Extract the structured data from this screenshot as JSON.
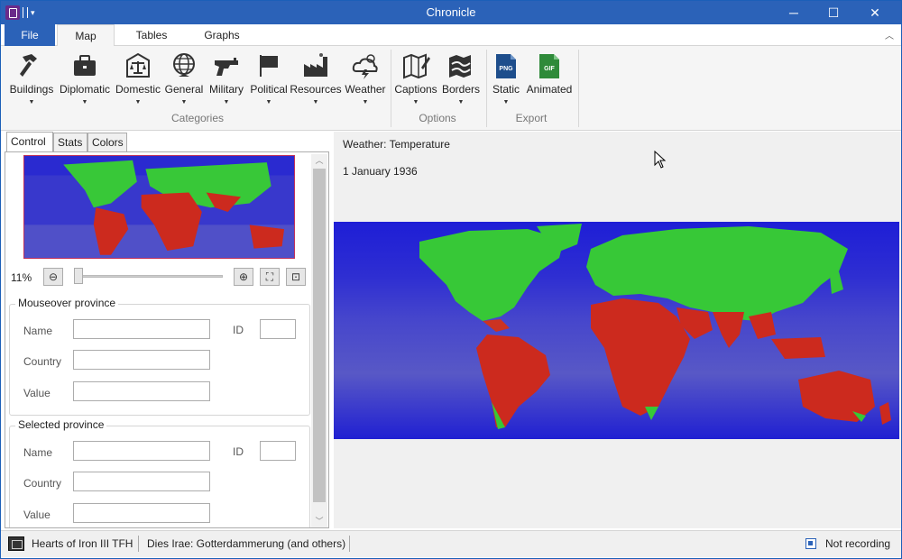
{
  "window": {
    "title": "Chronicle"
  },
  "tabs": [
    {
      "label": "File"
    },
    {
      "label": "Map"
    },
    {
      "label": "Tables"
    },
    {
      "label": "Graphs"
    }
  ],
  "ribbon": {
    "categories": {
      "label": "Categories",
      "buttons": [
        {
          "label": "Buildings",
          "icon": "hammer-icon"
        },
        {
          "label": "Diplomatic",
          "icon": "briefcase-icon"
        },
        {
          "label": "Domestic",
          "icon": "scales-icon"
        },
        {
          "label": "General",
          "icon": "globe-icon"
        },
        {
          "label": "Military",
          "icon": "gun-icon"
        },
        {
          "label": "Political",
          "icon": "flag-icon"
        },
        {
          "label": "Resources",
          "icon": "factory-icon"
        },
        {
          "label": "Weather",
          "icon": "storm-cloud-icon"
        }
      ]
    },
    "options": {
      "label": "Options",
      "buttons": [
        {
          "label": "Captions",
          "icon": "map-pencil-icon"
        },
        {
          "label": "Borders",
          "icon": "map-borders-icon"
        }
      ]
    },
    "export": {
      "label": "Export",
      "buttons": [
        {
          "label": "Static",
          "icon": "png-file-icon",
          "badge": "PNG"
        },
        {
          "label": "Animated",
          "icon": "gif-file-icon",
          "badge": "GIF"
        }
      ]
    }
  },
  "left_panel": {
    "tabs": [
      "Control",
      "Stats",
      "Colors"
    ],
    "zoom": {
      "level": "11%",
      "slider_fraction": 0.0
    },
    "mouseover": {
      "title": "Mouseover province",
      "name_label": "Name",
      "id_label": "ID",
      "country_label": "Country",
      "value_label": "Value",
      "name_value": "",
      "id_value": "",
      "country_value": "",
      "value_value": ""
    },
    "selected": {
      "title": "Selected province",
      "name_label": "Name",
      "id_label": "ID",
      "country_label": "Country",
      "value_label": "Value",
      "name_value": "",
      "id_value": "",
      "country_value": "",
      "value_value": ""
    }
  },
  "map_view": {
    "mode_label": "Weather: Temperature",
    "date": "1 January 1936"
  },
  "status": {
    "game": "Hearts of Iron III TFH",
    "mod": "Dies Irae: Gotterdammerung (and others)",
    "recording": "Not recording"
  },
  "colors": {
    "accent": "#2b62b8",
    "map_cold": "#3a3acc",
    "map_mild": "#33cc33",
    "map_hot": "#d62a1e"
  }
}
